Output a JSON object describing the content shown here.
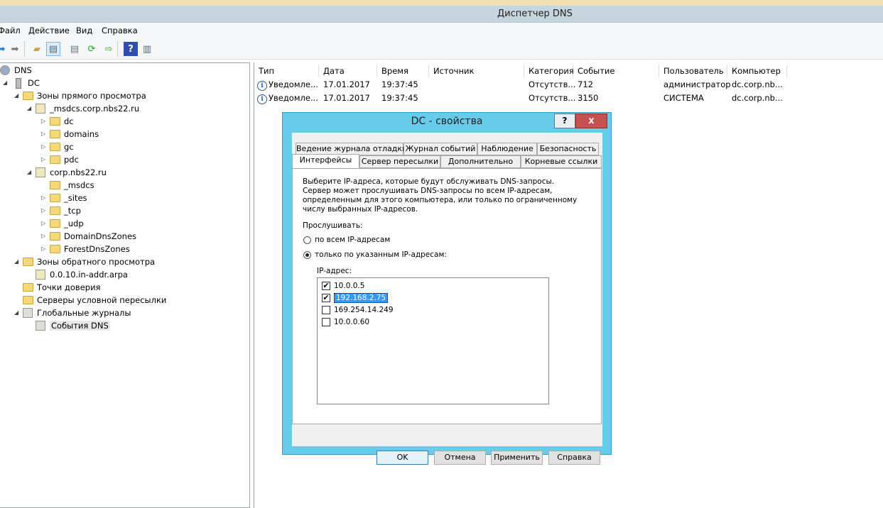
{
  "window": {
    "title": "Диспетчер DNS"
  },
  "menu": [
    "Файл",
    "Действие",
    "Вид",
    "Справка"
  ],
  "toolbar": [
    "back-icon",
    "forward-icon",
    "up-folder-icon",
    "show-hide-tree-icon",
    "properties-icon",
    "refresh-icon",
    "export-icon",
    "help-icon",
    "action-pane-icon"
  ],
  "tree": [
    {
      "label": "DNS",
      "level": 0,
      "icon": "dns-icon",
      "exp": ""
    },
    {
      "label": "DC",
      "level": 1,
      "icon": "server",
      "exp": "◢"
    },
    {
      "label": "Зоны прямого просмотра",
      "level": 2,
      "icon": "folder",
      "exp": "◢"
    },
    {
      "label": "_msdcs.corp.nbs22.ru",
      "level": 3,
      "icon": "zone",
      "exp": "◢"
    },
    {
      "label": "dc",
      "level": 4,
      "icon": "folder",
      "exp": "▷"
    },
    {
      "label": "domains",
      "level": 4,
      "icon": "folder",
      "exp": "▷"
    },
    {
      "label": "gc",
      "level": 4,
      "icon": "folder",
      "exp": "▷"
    },
    {
      "label": "pdc",
      "level": 4,
      "icon": "folder",
      "exp": "▷"
    },
    {
      "label": "corp.nbs22.ru",
      "level": 3,
      "icon": "zone",
      "exp": "◢"
    },
    {
      "label": "_msdcs",
      "level": 4,
      "icon": "folder",
      "exp": ""
    },
    {
      "label": "_sites",
      "level": 4,
      "icon": "folder",
      "exp": "▷"
    },
    {
      "label": "_tcp",
      "level": 4,
      "icon": "folder",
      "exp": "▷"
    },
    {
      "label": "_udp",
      "level": 4,
      "icon": "folder",
      "exp": "▷"
    },
    {
      "label": "DomainDnsZones",
      "level": 4,
      "icon": "folder",
      "exp": "▷"
    },
    {
      "label": "ForestDnsZones",
      "level": 4,
      "icon": "folder",
      "exp": "▷"
    },
    {
      "label": "Зоны обратного просмотра",
      "level": 2,
      "icon": "folder",
      "exp": "◢"
    },
    {
      "label": "0.0.10.in-addr.arpa",
      "level": 3,
      "icon": "zone",
      "exp": ""
    },
    {
      "label": "Точки доверия",
      "level": 2,
      "icon": "folder",
      "exp": ""
    },
    {
      "label": "Серверы условной пересылки",
      "level": 2,
      "icon": "folder",
      "exp": ""
    },
    {
      "label": "Глобальные журналы",
      "level": 2,
      "icon": "log",
      "exp": "◢"
    },
    {
      "label": "События DNS",
      "level": 3,
      "icon": "log",
      "exp": ""
    }
  ],
  "events": {
    "columns": [
      "Тип",
      "Дата",
      "Время",
      "Источник",
      "Категория",
      "Событие",
      "Пользователь",
      "Компьютер"
    ],
    "rows": [
      [
        "Уведомле...",
        "17.01.2017",
        "19:37:45",
        "",
        "Отсутств...",
        "712",
        "администратор",
        "dc.corp.nb..."
      ],
      [
        "Уведомле...",
        "17.01.2017",
        "19:37:45",
        "",
        "Отсутств...",
        "3150",
        "СИСТЕМА",
        "dc.corp.nb..."
      ]
    ]
  },
  "dialog": {
    "title": "DC - свойства",
    "help": "?",
    "close": "x",
    "tabs_row1": [
      "Ведение журнала отладки",
      "Журнал событий",
      "Наблюдение",
      "Безопасность"
    ],
    "tabs_row2": [
      "Интерфейсы",
      "Сервер пересылки",
      "Дополнительно",
      "Корневые ссылки"
    ],
    "active_tab": "Интерфейсы",
    "description": [
      "Выберите IP-адреса, которые будут обслуживать DNS-запросы.",
      "Сервер может прослушивать DNS-запросы по всем IP-адресам,",
      "определенным для этого компьютера, или только по ограниченному",
      "числу выбранных IP-адресов."
    ],
    "listen_label": "Прослушивать:",
    "radio_all": "по всем IP-адресам",
    "radio_only": "только по указанным IP-адресам:",
    "radio_selected": "only",
    "ip_label": "IP-адрес:",
    "ips": [
      {
        "ip": "10.0.0.5",
        "checked": true
      },
      {
        "ip": "192.168.2.75",
        "checked": true,
        "selected": true
      },
      {
        "ip": "169.254.14.249",
        "checked": false
      },
      {
        "ip": "10.0.0.60",
        "checked": false
      }
    ],
    "buttons": [
      "OK",
      "Отмена",
      "Применить",
      "Справка"
    ]
  }
}
